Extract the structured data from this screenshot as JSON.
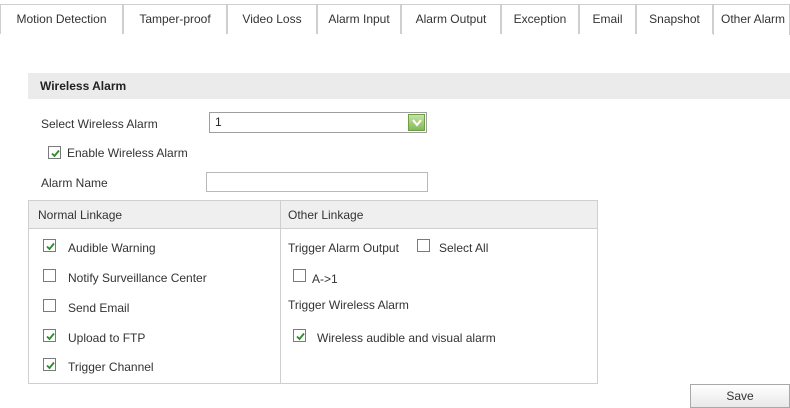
{
  "tabs": [
    {
      "label": "Motion Detection",
      "active": false
    },
    {
      "label": "Tamper-proof",
      "active": false
    },
    {
      "label": "Video Loss",
      "active": false
    },
    {
      "label": "Alarm Input",
      "active": false
    },
    {
      "label": "Alarm Output",
      "active": false
    },
    {
      "label": "Exception",
      "active": false
    },
    {
      "label": "Email",
      "active": false
    },
    {
      "label": "Snapshot",
      "active": false
    },
    {
      "label": "Other Alarm",
      "active": true
    }
  ],
  "section": {
    "title": "Wireless Alarm"
  },
  "form": {
    "select_label": "Select Wireless Alarm",
    "select_value": "1",
    "enable_label": "Enable Wireless Alarm",
    "enable_checked": true,
    "alarm_name_label": "Alarm Name",
    "alarm_name_value": ""
  },
  "linkage": {
    "normal_header": "Normal Linkage",
    "other_header": "Other Linkage",
    "normal_items": [
      {
        "label": "Audible Warning",
        "checked": true
      },
      {
        "label": "Notify Surveillance Center",
        "checked": false
      },
      {
        "label": "Send Email",
        "checked": false
      },
      {
        "label": "Upload to FTP",
        "checked": true
      },
      {
        "label": "Trigger Channel",
        "checked": true
      }
    ],
    "trigger_output_label": "Trigger Alarm Output",
    "select_all_label": "Select All",
    "select_all_checked": false,
    "output_item": {
      "label": "A->1",
      "checked": false
    },
    "trigger_wireless_label": "Trigger Wireless Alarm",
    "wireless_item": {
      "label": "Wireless audible and visual alarm",
      "checked": true
    }
  },
  "save_label": "Save",
  "colors": {
    "check": "#2e8b2e",
    "dropdown_arrow": "#83b958",
    "header_bg": "#ebebeb"
  }
}
